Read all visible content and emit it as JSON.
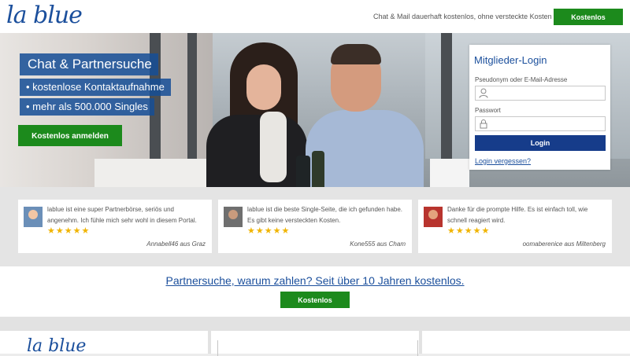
{
  "header": {
    "logo": "la blue",
    "tagline": "Chat & Mail dauerhaft kostenlos, ohne versteckte Kosten",
    "signup_label": "Kostenlos anmelden"
  },
  "hero": {
    "headline": "Chat & Partnersuche",
    "bullets": [
      "• kostenlose Kontaktaufnahme",
      "• mehr als 500.000 Singles"
    ],
    "cta_label": "Kostenlos anmelden"
  },
  "login": {
    "title": "Mitglieder-Login",
    "user_label": "Pseudonym oder E-Mail-Adresse",
    "user_value": "",
    "password_label": "Passwort",
    "password_value": "",
    "submit_label": "Login",
    "forgot_label": "Login vergessen?"
  },
  "reviews": [
    {
      "text": "lablue ist eine super Partnerbörse, seriös und angenehm. Ich fühle mich sehr wohl in diesem Portal.",
      "stars": "★★★★★",
      "rating": 5,
      "author": "Annabell46 aus Graz",
      "avatar_colors": [
        "#f3c6a4",
        "#6b8fb8"
      ]
    },
    {
      "text": "lablue ist die beste Single-Seite, die ich gefunden habe. Es gibt keine versteckten Kosten.",
      "stars": "★★★★★",
      "rating": 5,
      "author": "Kone555 aus Cham",
      "avatar_colors": [
        "#c99b7d",
        "#6f6f6f"
      ]
    },
    {
      "text": "Danke für die prompte Hilfe. Es ist einfach toll, wie schnell reagiert wird.",
      "stars": "★★★★★",
      "rating": 5,
      "author": "oomaberenice aus Miltenberg",
      "avatar_colors": [
        "#e3a47d",
        "#b8342e"
      ]
    }
  ],
  "promo": {
    "headline": "Partnersuche, warum zahlen? Seit über 10 Jahren kostenlos.",
    "cta_label": "Kostenlos anmelden"
  },
  "footer": {
    "logo": "la blue"
  },
  "colors": {
    "brand_blue": "#1b4f9c",
    "login_button": "#163c8a",
    "cta_green": "#1c8a1c",
    "star": "#f0b400"
  }
}
